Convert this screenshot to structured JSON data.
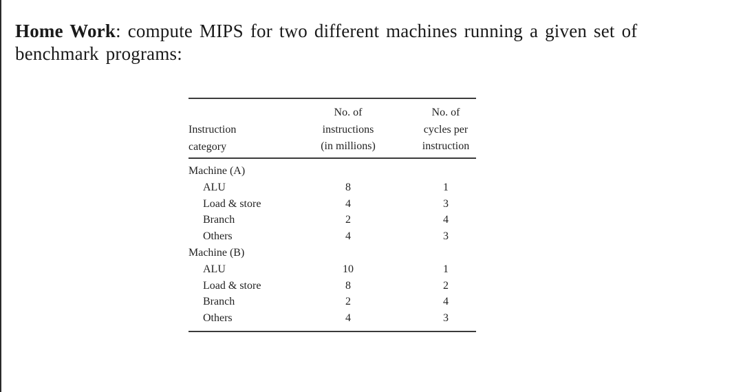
{
  "heading": {
    "bold_part": "Home Work",
    "rest": ": compute MIPS for two different machines running a given set of benchmark programs:"
  },
  "table": {
    "columns": [
      {
        "lines": [
          "Instruction",
          "category"
        ]
      },
      {
        "lines": [
          "No. of",
          "instructions",
          "(in millions)"
        ]
      },
      {
        "lines": [
          "No. of",
          "cycles per",
          "instruction"
        ]
      }
    ],
    "groups": [
      {
        "label": "Machine (A)",
        "rows": [
          {
            "category": "ALU",
            "instructions": "8",
            "cpi": "1"
          },
          {
            "category": "Load & store",
            "instructions": "4",
            "cpi": "3"
          },
          {
            "category": "Branch",
            "instructions": "2",
            "cpi": "4"
          },
          {
            "category": "Others",
            "instructions": "4",
            "cpi": "3"
          }
        ]
      },
      {
        "label": "Machine (B)",
        "rows": [
          {
            "category": "ALU",
            "instructions": "10",
            "cpi": "1"
          },
          {
            "category": "Load & store",
            "instructions": "8",
            "cpi": "2"
          },
          {
            "category": "Branch",
            "instructions": "2",
            "cpi": "4"
          },
          {
            "category": "Others",
            "instructions": "4",
            "cpi": "3"
          }
        ]
      }
    ]
  }
}
